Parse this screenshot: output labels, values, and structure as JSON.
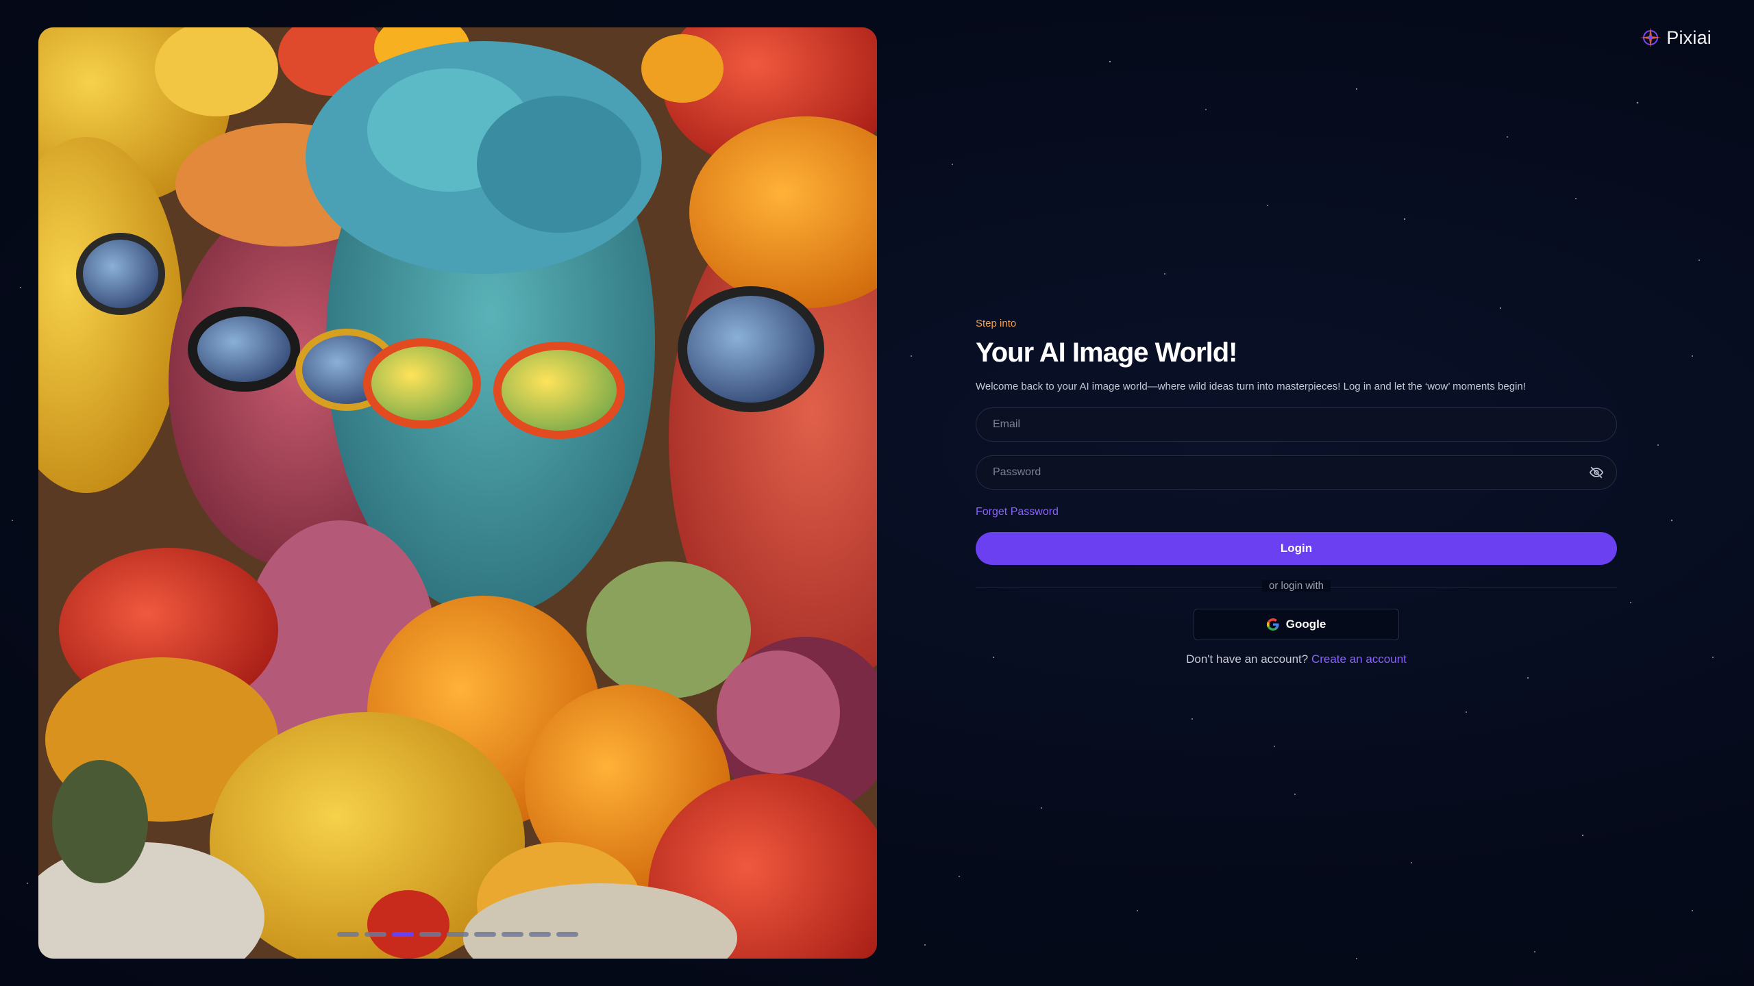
{
  "brand": {
    "name": "Pixiai",
    "logo_icon": "compass-star-icon"
  },
  "hero": {
    "carousel": {
      "total_slides": 9,
      "active_index": 2
    }
  },
  "form": {
    "eyebrow": "Step into",
    "title": "Your AI Image World!",
    "subtitle": "Welcome back to your AI image world—where wild ideas turn into masterpieces! Log in and let the ‘wow’ moments begin!",
    "email": {
      "placeholder": "Email",
      "value": ""
    },
    "password": {
      "placeholder": "Password",
      "value": "",
      "toggle_icon": "eye-off-icon"
    },
    "forgot_label": "Forget Password",
    "login_label": "Login",
    "divider_label": "or login with",
    "google_label": "Google",
    "signup_prompt": "Don't have an account?",
    "signup_link": "Create an account"
  },
  "colors": {
    "background": "#050a1a",
    "accent": "#6a40f0",
    "link": "#8a62ff",
    "eyebrow": "#f3a04c"
  }
}
